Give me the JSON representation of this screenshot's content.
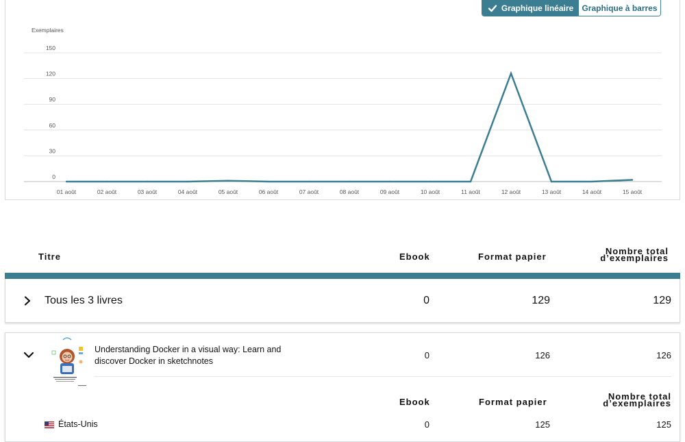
{
  "chart_toggle": {
    "line_label": "Graphique linéaire",
    "bar_label": "Graphique à barres",
    "active": "line"
  },
  "colors": {
    "accent": "#3b7d91",
    "line": "#3b7d91"
  },
  "chart_data": {
    "type": "line",
    "ylabel": "Exemplaires",
    "xlabel": "",
    "ylim": [
      0,
      150
    ],
    "yticks": [
      0,
      30,
      60,
      90,
      120,
      150
    ],
    "categories": [
      "01 août",
      "02 août",
      "03 août",
      "04 août",
      "05 août",
      "06 août",
      "07 août",
      "08 août",
      "09 août",
      "10 août",
      "11 août",
      "12 août",
      "13 août",
      "14 août",
      "15 août"
    ],
    "series": [
      {
        "values": [
          0,
          0,
          0,
          0,
          1,
          0,
          0,
          0,
          0,
          0,
          0,
          126,
          0,
          0,
          2
        ]
      }
    ],
    "grid": true
  },
  "table": {
    "headers": {
      "title": "Titre",
      "ebook": "Ebook",
      "paper": "Format papier",
      "total_line1": "Nombre total",
      "total_line2": "d’exemplaires"
    },
    "summary": {
      "label": "Tous les 3 livres",
      "ebook": "0",
      "paper": "129",
      "total": "129"
    },
    "book": {
      "title_line1": "Understanding Docker in a visual way: Learn and",
      "title_line2": "discover Docker in sketchnotes",
      "ebook": "0",
      "paper": "126",
      "total": "126",
      "sub_headers": {
        "ebook": "Ebook",
        "paper": "Format papier",
        "total_line1": "Nombre total",
        "total_line2": "d’exemplaires"
      },
      "marketplace": {
        "name": "États-Unis",
        "ebook": "0",
        "paper": "125",
        "total": "125"
      }
    }
  }
}
